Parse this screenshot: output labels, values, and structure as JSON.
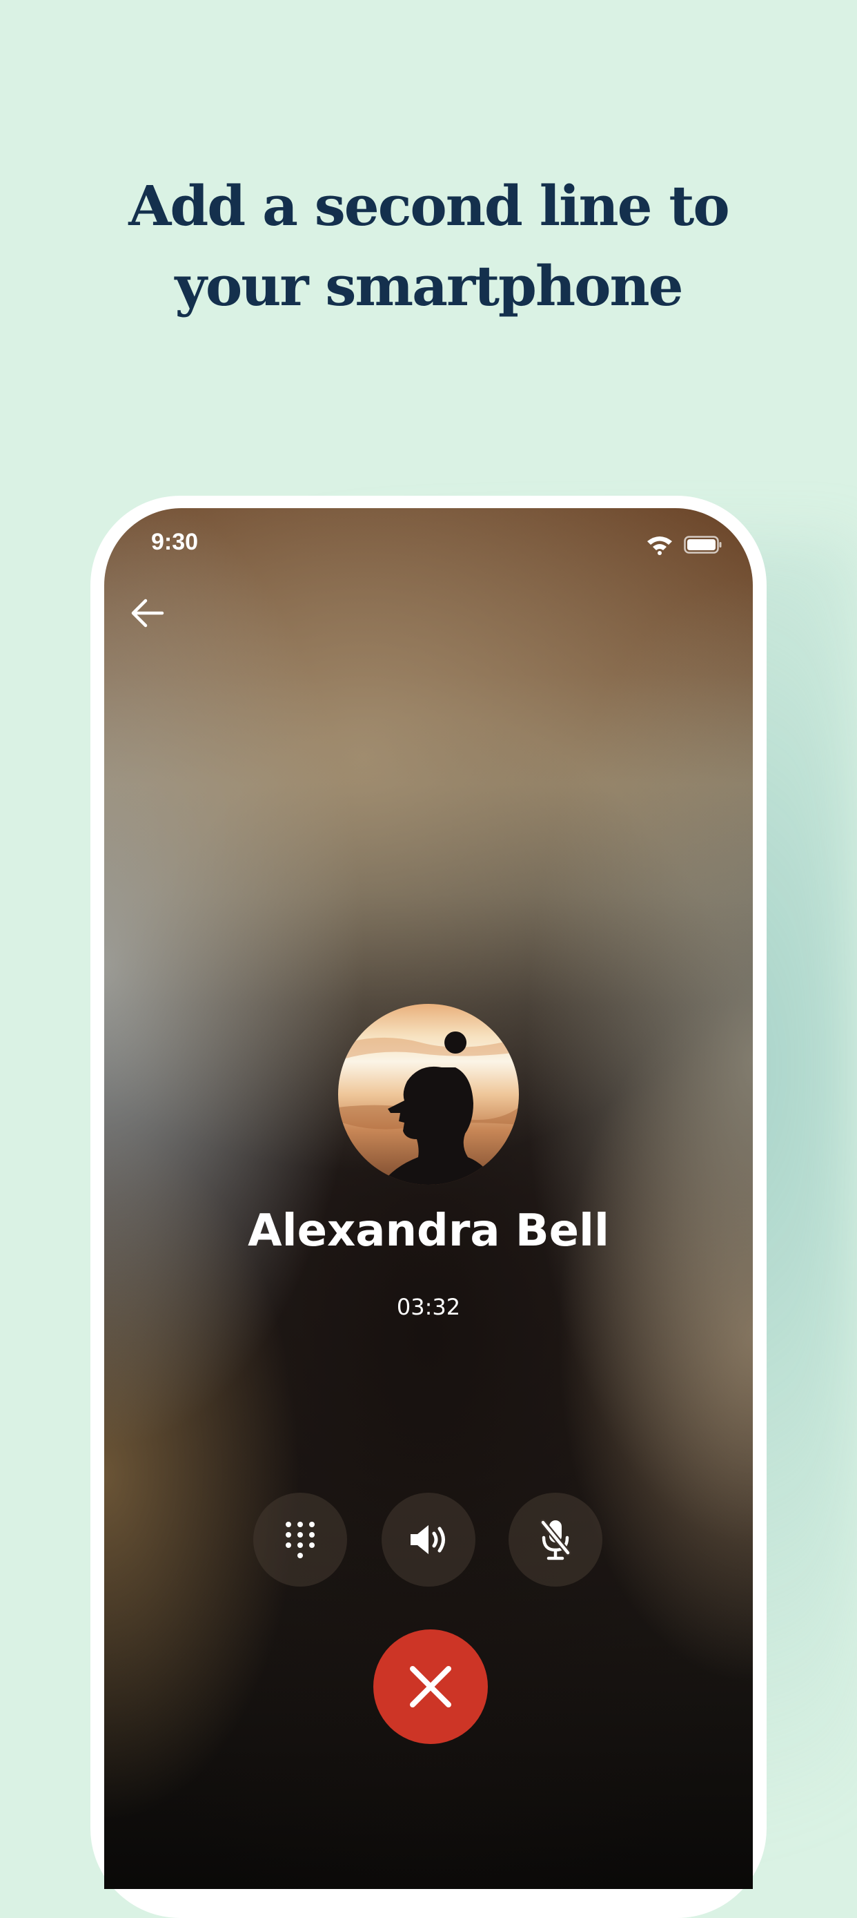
{
  "headline": {
    "line1": "Add a second line to",
    "line2": "your smartphone"
  },
  "status_bar": {
    "time": "9:30",
    "icons": [
      "wifi-icon",
      "battery-icon"
    ]
  },
  "call": {
    "caller_name": "Alexandra Bell",
    "duration": "03:32"
  },
  "controls": [
    {
      "name": "keypad",
      "icon": "keypad-icon"
    },
    {
      "name": "speaker",
      "icon": "speaker-icon"
    },
    {
      "name": "mute",
      "icon": "mic-off-icon"
    }
  ],
  "hangup": {
    "icon": "close-icon",
    "color": "#cd3526"
  },
  "colors": {
    "background": "#daf2e4",
    "headline": "#14304d",
    "hangup": "#cd3526"
  }
}
